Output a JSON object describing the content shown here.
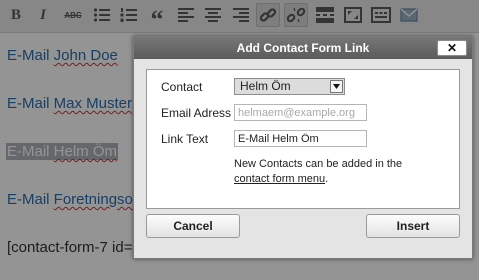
{
  "toolbar": {
    "buttons": [
      {
        "icon": "bold-icon",
        "glyph": "B"
      },
      {
        "icon": "italic-icon",
        "glyph": "I"
      },
      {
        "icon": "strikethrough-icon",
        "glyph": "ABC"
      },
      {
        "icon": "bullet-list-icon"
      },
      {
        "icon": "numbered-list-icon"
      },
      {
        "icon": "blockquote-icon",
        "glyph": "“"
      },
      {
        "icon": "align-left-icon"
      },
      {
        "icon": "align-center-icon"
      },
      {
        "icon": "align-right-icon"
      },
      {
        "icon": "insert-link-icon"
      },
      {
        "icon": "unlink-icon"
      },
      {
        "icon": "insert-more-icon"
      },
      {
        "icon": "fullscreen-icon"
      },
      {
        "icon": "kitchen-sink-icon"
      },
      {
        "icon": "contact-form-link-icon"
      }
    ]
  },
  "editor": {
    "lines": [
      {
        "prefix": "E-Mail ",
        "name": "John Doe"
      },
      {
        "prefix": "E-Mail ",
        "name": "Max Muster"
      },
      {
        "prefix": "E-Mail ",
        "name": "Helm Öm"
      },
      {
        "prefix": "E-Mail ",
        "name": "Foretningsor"
      },
      {
        "prefix": "",
        "name": "[contact-form-7 id=\""
      }
    ]
  },
  "dialog": {
    "title": "Add Contact Form Link",
    "close_label": "✕",
    "contact_label": "Contact",
    "contact_selected": "Helm Öm",
    "email_label": "Email Adress",
    "email_placeholder": "helmaem@example.org",
    "email_value": "",
    "link_text_label": "Link Text",
    "link_text_value": "E-Mail Helm Öm",
    "note_line1": "New Contacts can be added in the",
    "note_link": "contact form menu",
    "note_end": ".",
    "cancel_label": "Cancel",
    "insert_label": "Insert"
  }
}
